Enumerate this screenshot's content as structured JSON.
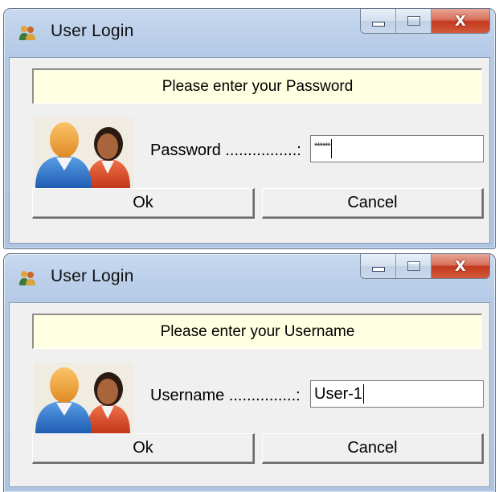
{
  "dialogs": [
    {
      "title": "User Login",
      "banner": "Please enter your Password",
      "field_label": "Password ................:",
      "field_value": "******",
      "ok_label": "Ok",
      "cancel_label": "Cancel",
      "close_glyph": "X"
    },
    {
      "title": "User Login",
      "banner": "Please enter your Username",
      "field_label": "Username ...............:",
      "field_value": "User-1",
      "ok_label": "Ok",
      "cancel_label": "Cancel",
      "close_glyph": "X"
    }
  ],
  "icons": {
    "app": "users-icon",
    "user_picture": "users-icon",
    "minimize": "minimize-icon",
    "maximize": "maximize-icon",
    "close": "close-icon"
  },
  "colors": {
    "banner_bg": "#ffffe1",
    "client_bg": "#f0f0f0",
    "frame": "#bcd0ea",
    "close_red": "#c3391f"
  }
}
